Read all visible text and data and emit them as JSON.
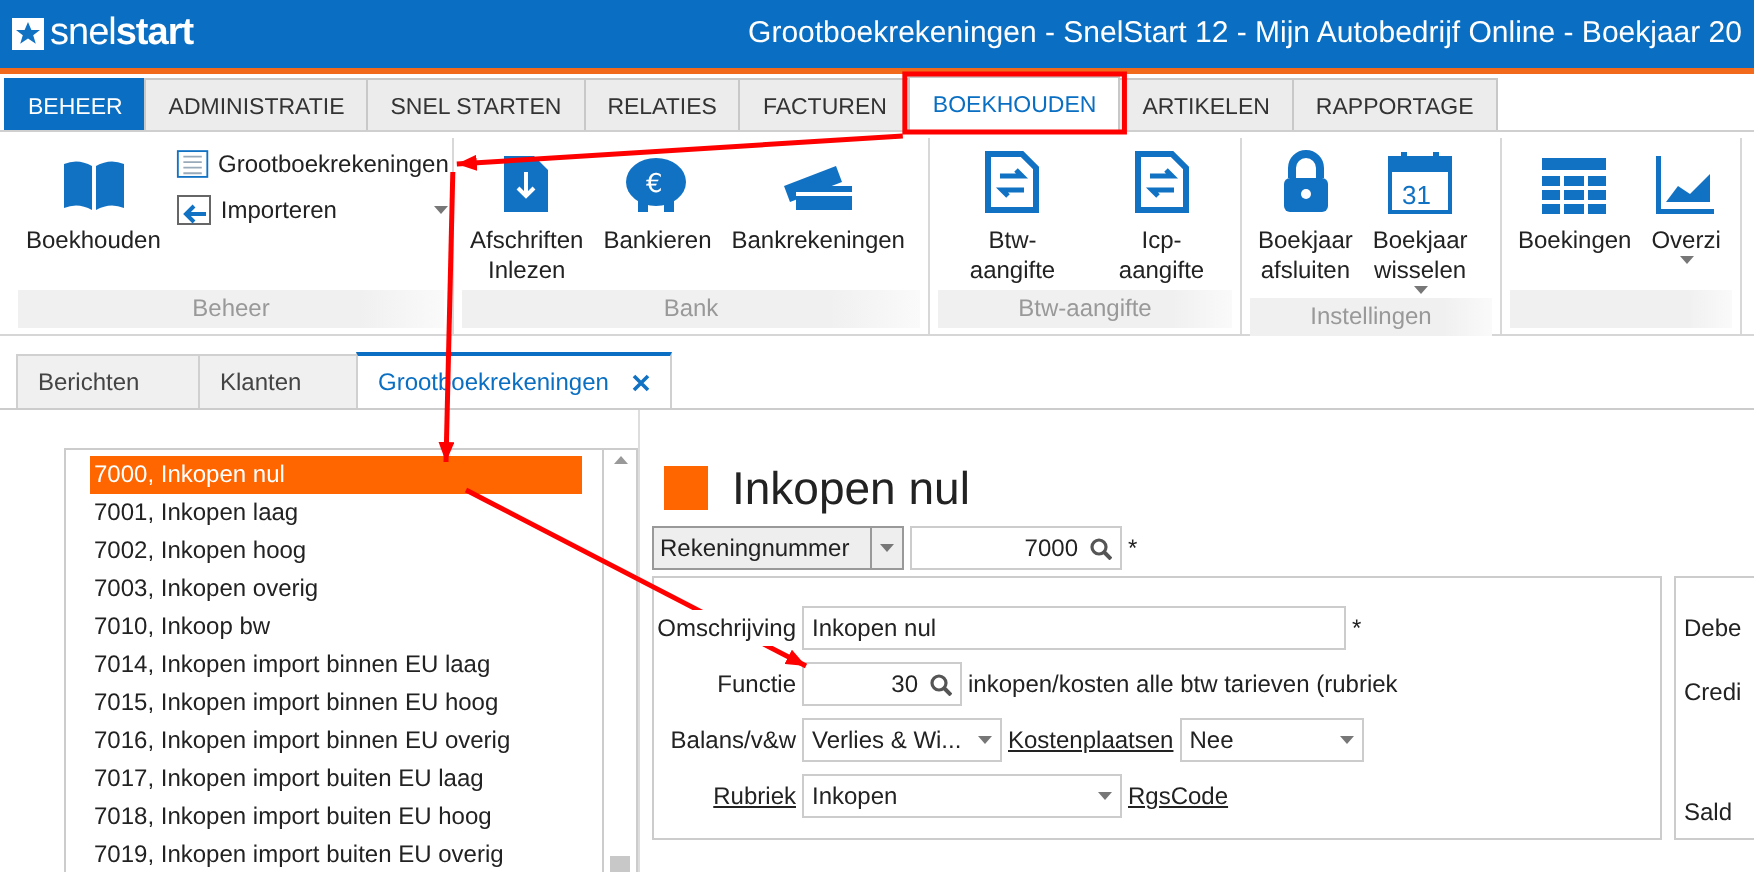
{
  "window": {
    "title": "Grootboekrekeningen - SnelStart 12 - Mijn Autobedrijf Online - Boekjaar 20",
    "logo_light": "snel",
    "logo_bold": "start"
  },
  "menu_tabs": [
    {
      "label": "BEHEER",
      "kind": "app",
      "selected": false
    },
    {
      "label": "ADMINISTRATIE",
      "kind": "tab",
      "selected": false
    },
    {
      "label": "SNEL STARTEN",
      "kind": "tab",
      "selected": false
    },
    {
      "label": "RELATIES",
      "kind": "tab",
      "selected": false
    },
    {
      "label": "FACTUREN",
      "kind": "tab",
      "selected": false
    },
    {
      "label": "BOEKHOUDEN",
      "kind": "tab",
      "selected": true
    },
    {
      "label": "ARTIKELEN",
      "kind": "tab",
      "selected": false
    },
    {
      "label": "RAPPORTAGE",
      "kind": "tab",
      "selected": false
    }
  ],
  "ribbon_groups": [
    {
      "label": "Beheer",
      "items": [
        {
          "kind": "large",
          "label": "Boekhouden",
          "dropdown": false
        },
        {
          "kind": "small",
          "label": "Grootboekrekeningen",
          "dropdown": false
        },
        {
          "kind": "small",
          "label": "Importeren",
          "dropdown": true
        }
      ]
    },
    {
      "label": "Bank",
      "items": [
        {
          "kind": "large",
          "label": "Afschriften\nInlezen",
          "dropdown": false
        },
        {
          "kind": "large",
          "label": "Bankieren",
          "dropdown": false,
          "icon_text": "€"
        },
        {
          "kind": "large",
          "label": "Bankrekeningen",
          "dropdown": false
        }
      ]
    },
    {
      "label": "Btw-aangifte",
      "items": [
        {
          "kind": "large",
          "label": "Btw-aangifte",
          "dropdown": false
        },
        {
          "kind": "large",
          "label": "Icp-aangifte",
          "dropdown": false
        }
      ]
    },
    {
      "label": "Instellingen",
      "items": [
        {
          "kind": "large",
          "label": "Boekjaar\nafsluiten",
          "dropdown": false
        },
        {
          "kind": "large",
          "label": "Boekjaar\nwisselen",
          "dropdown": true,
          "icon_text": "31"
        }
      ]
    },
    {
      "items": [
        {
          "kind": "large",
          "label": "Boekingen",
          "dropdown": false
        },
        {
          "kind": "large",
          "label": "Overzi",
          "dropdown": true
        }
      ]
    }
  ],
  "doc_tabs": [
    {
      "label": "Berichten",
      "selected": false,
      "closable": false
    },
    {
      "label": "Klanten",
      "selected": false,
      "closable": false
    },
    {
      "label": "Grootboekrekeningen",
      "selected": true,
      "closable": true
    }
  ],
  "accounts": [
    {
      "label": "7000, Inkopen nul",
      "selected": true
    },
    {
      "label": "7001, Inkopen laag",
      "selected": false
    },
    {
      "label": "7002, Inkopen hoog",
      "selected": false
    },
    {
      "label": "7003, Inkopen overig",
      "selected": false
    },
    {
      "label": "7010, Inkoop bw",
      "selected": false
    },
    {
      "label": "7014, Inkopen import binnen EU laag",
      "selected": false
    },
    {
      "label": "7015, Inkopen import binnen EU hoog",
      "selected": false
    },
    {
      "label": "7016, Inkopen import binnen EU overig",
      "selected": false
    },
    {
      "label": "7017, Inkopen import buiten EU laag",
      "selected": false
    },
    {
      "label": "7018, Inkopen import buiten EU hoog",
      "selected": false
    },
    {
      "label": "7019, Inkopen import buiten EU overig",
      "selected": false
    }
  ],
  "detail": {
    "title": "Inkopen nul",
    "color": "#ff6600",
    "key_select": "Rekeningnummer",
    "key_value": "7000",
    "required_mark": "*",
    "description_label": "Omschrijving",
    "description_value": "Inkopen nul",
    "description_required": "*",
    "function_label": "Functie",
    "function_value": "30",
    "function_text": "inkopen/kosten alle btw tarieven (rubriek",
    "balance_label": "Balans/v&w",
    "balance_value": "Verlies & Wi...",
    "cost_label": "Kostenplaatsen",
    "cost_value": "Nee",
    "rubric_label": "Rubriek",
    "rubric_value": "Inkopen",
    "rgs_label": "RgsCode",
    "side_labels": [
      "Debe",
      "Credi",
      "Sald"
    ]
  }
}
